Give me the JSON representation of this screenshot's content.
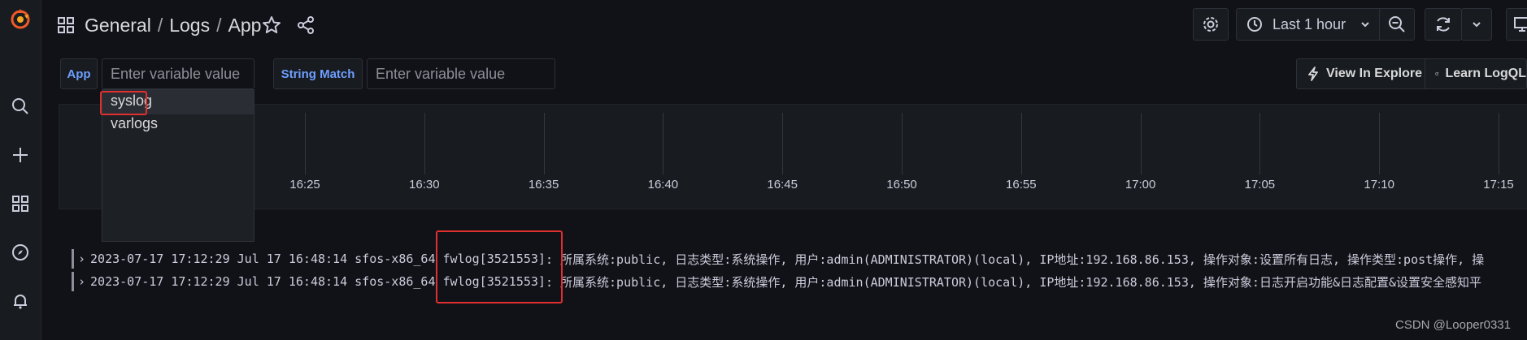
{
  "breadcrumb": {
    "folder": "General",
    "section": "Logs",
    "dashboard": "App",
    "separator": "/"
  },
  "icons": {
    "logo": "grafana-logo-icon",
    "search": "search-icon",
    "create": "plus-icon",
    "dashboards": "dashboards-grid-icon",
    "explore": "compass-icon",
    "alerting": "bell-icon",
    "star": "star-icon",
    "share": "share-icon",
    "settings": "gear-icon",
    "clock": "clock-icon",
    "zoom_out": "zoom-out-icon",
    "refresh": "refresh-icon"
  },
  "toolbar": {
    "time_range": "Last 1 hour"
  },
  "variables": [
    {
      "label": "App",
      "placeholder": "Enter variable value"
    },
    {
      "label": "String Match",
      "placeholder": "Enter variable value"
    }
  ],
  "dropdown": {
    "options": [
      "syslog",
      "varlogs"
    ]
  },
  "links": {
    "explore": "View In Explore",
    "learn": "Learn LogQL"
  },
  "chart_data": {
    "type": "bar",
    "x_ticks": [
      "16:25",
      "16:30",
      "16:35",
      "16:40",
      "16:45",
      "16:50",
      "16:55",
      "17:00",
      "17:05",
      "17:10",
      "17:15"
    ],
    "series": []
  },
  "logs": [
    {
      "timestamp": "2023-07-17 17:12:29",
      "pre": "Jul 17 16:48:14 sfos-x86_64",
      "proc": "fwlog[3521553]",
      "msg": ": 所属系统:public, 日志类型:系统操作, 用户:admin(ADMINISTRATOR)(local), IP地址:192.168.86.153, 操作对象:设置所有日志, 操作类型:post操作, 操"
    },
    {
      "timestamp": "2023-07-17 17:12:29",
      "pre": "Jul 17 16:48:14 sfos-x86_64",
      "proc": "fwlog[3521553]",
      "msg": ": 所属系统:public, 日志类型:系统操作, 用户:admin(ADMINISTRATOR)(local), IP地址:192.168.86.153, 操作对象:日志开启功能&日志配置&设置安全感知平"
    }
  ],
  "watermark": "CSDN @Looper0331",
  "colors": {
    "accent": "#6e9fff",
    "highlight": "#e02f2f",
    "background": "#111217",
    "panel": "#181b1f",
    "logo": "#f05a28"
  }
}
